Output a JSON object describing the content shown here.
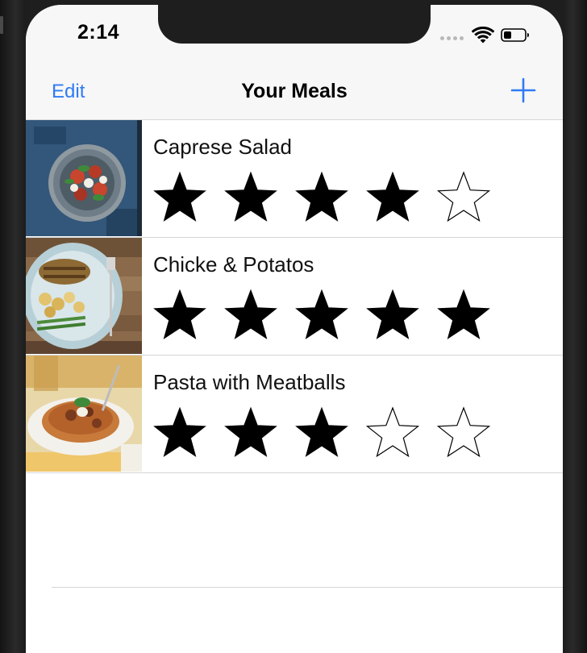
{
  "status_bar": {
    "time": "2:14",
    "icons": [
      "signal-dots-icon",
      "wifi-icon",
      "battery-icon"
    ]
  },
  "nav": {
    "edit_label": "Edit",
    "title": "Your Meals",
    "add_icon": "plus-icon"
  },
  "colors": {
    "accent": "#2f7bf5",
    "star_filled": "#000000"
  },
  "meals": [
    {
      "name": "Caprese Salad",
      "rating": 4,
      "max_rating": 5,
      "photo": "caprese-salad-photo"
    },
    {
      "name": "Chicke & Potatos",
      "rating": 5,
      "max_rating": 5,
      "photo": "chicken-potatoes-photo"
    },
    {
      "name": "Pasta with Meatballs",
      "rating": 3,
      "max_rating": 5,
      "photo": "pasta-meatballs-photo"
    }
  ]
}
